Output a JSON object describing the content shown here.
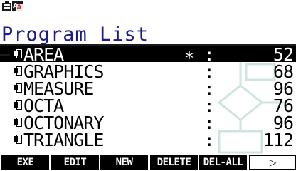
{
  "status_bar": {
    "battery_icon": "battery-icon",
    "input_mode_icon": "alpha-input-icon",
    "input_mode_text": "A",
    "input_mode_subtext": "A"
  },
  "page_title": "Program List",
  "colors": {
    "title": "#1a1a8a",
    "selected_bg": "#000000",
    "selected_fg": "#ffffff",
    "text": "#000000",
    "alpha_red": "#d42020",
    "diagram": "#cfe3df"
  },
  "programs": [
    {
      "name": "AREA",
      "flag": "∗",
      "colon": ":",
      "size": "52",
      "selected": true
    },
    {
      "name": "GRAPHICS",
      "flag": "",
      "colon": ":",
      "size": "68",
      "selected": false
    },
    {
      "name": "MEASURE",
      "flag": "",
      "colon": ":",
      "size": "96",
      "selected": false
    },
    {
      "name": "OCTA",
      "flag": "",
      "colon": ":",
      "size": "76",
      "selected": false
    },
    {
      "name": "OCTONARY",
      "flag": "",
      "colon": ":",
      "size": "96",
      "selected": false
    },
    {
      "name": "TRIANGLE",
      "flag": "",
      "colon": ":",
      "size": "112",
      "selected": false
    }
  ],
  "function_keys": [
    {
      "label": "EXE",
      "name": "exe-key"
    },
    {
      "label": "EDIT",
      "name": "edit-key"
    },
    {
      "label": "NEW",
      "name": "new-key"
    },
    {
      "label": "DELETE",
      "name": "delete-key"
    },
    {
      "label": "DEL-ALL",
      "name": "del-all-key"
    },
    {
      "label": "▷",
      "name": "next-menu-key"
    }
  ]
}
